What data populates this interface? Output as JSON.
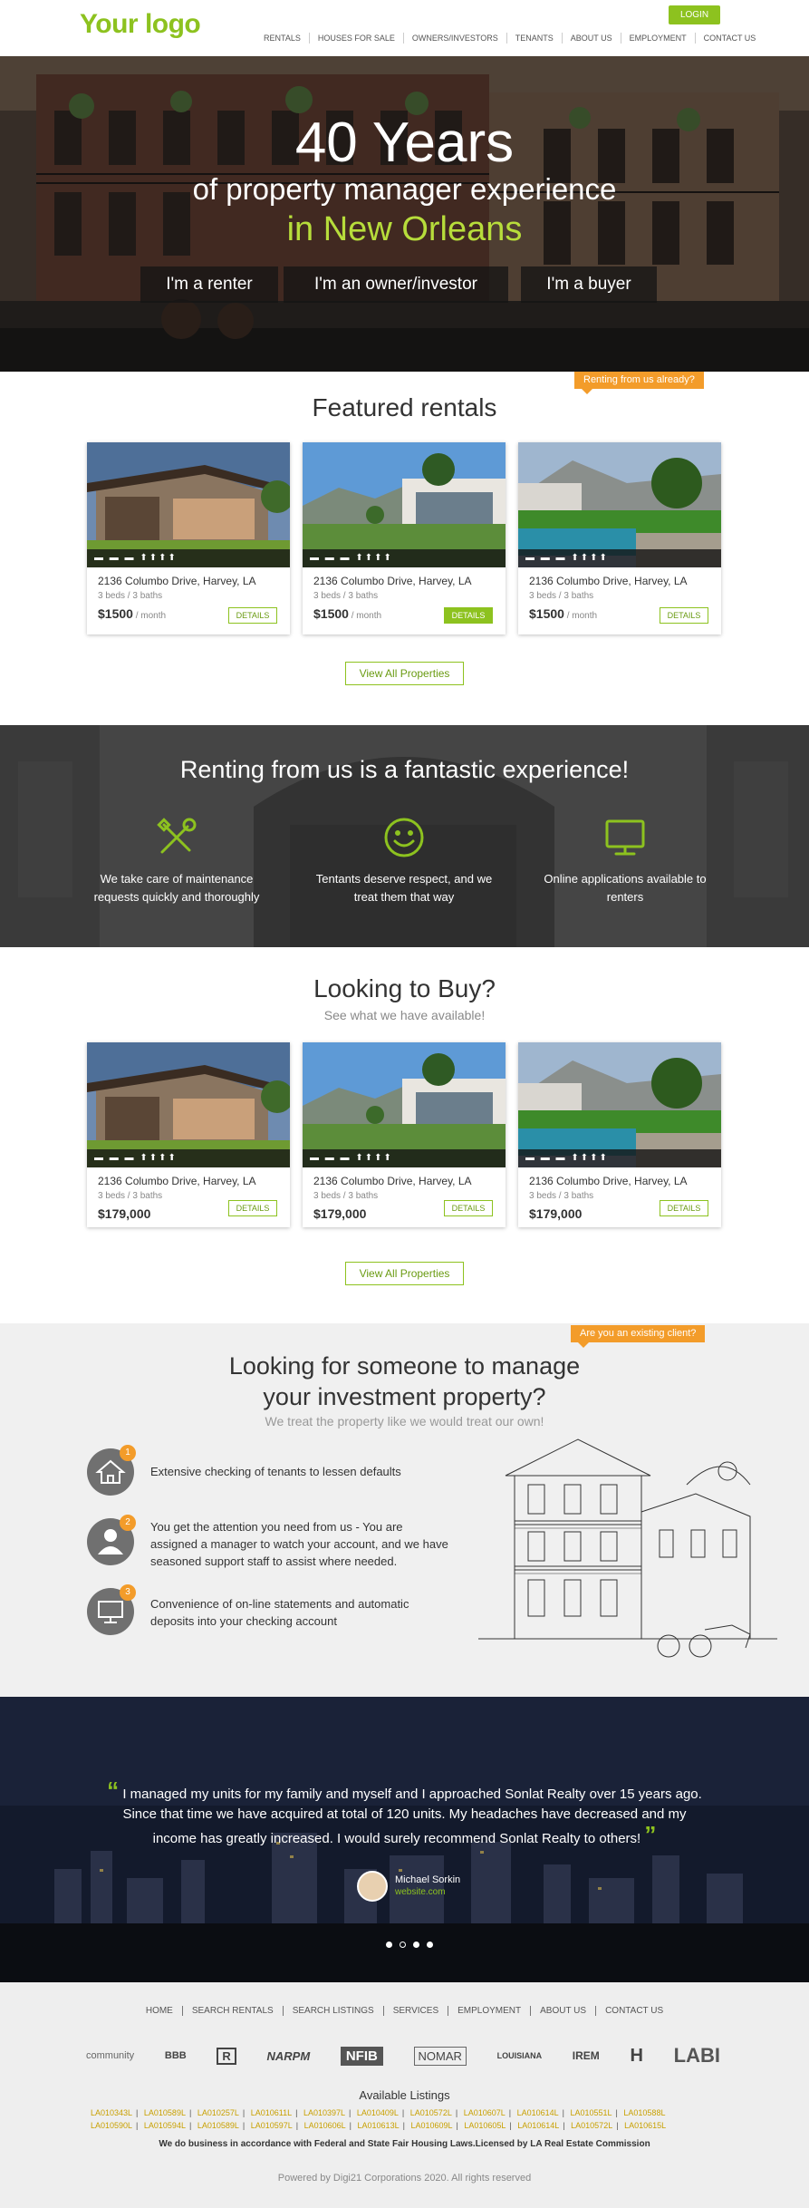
{
  "header": {
    "logo": "Your logo",
    "login": "LOGIN",
    "nav": [
      "RENTALS",
      "HOUSES FOR SALE",
      "OWNERS/INVESTORS",
      "TENANTS",
      "ABOUT US",
      "EMPLOYMENT",
      "CONTACT US"
    ]
  },
  "hero": {
    "title": "40 Years",
    "subtitle": "of property manager experience",
    "city": "in New Orleans",
    "buttons": [
      "I'm a renter",
      "I'm an owner/investor",
      "I'm a buyer"
    ]
  },
  "featured": {
    "tag": "Renting from us already?",
    "title": "Featured rentals",
    "cards": [
      {
        "address": "2136 Columbo Drive, Harvey, LA",
        "beds": "3 beds / 3 baths",
        "price": "$1500",
        "per": " / month",
        "details": "DETAILS"
      },
      {
        "address": "2136 Columbo Drive, Harvey, LA",
        "beds": "3 beds / 3 baths",
        "price": "$1500",
        "per": " / month",
        "details": "DETAILS"
      },
      {
        "address": "2136 Columbo Drive, Harvey, LA",
        "beds": "3 beds / 3 baths",
        "price": "$1500",
        "per": " / month",
        "details": "DETAILS"
      }
    ],
    "view_all": "View All Properties"
  },
  "renting": {
    "title": "Renting from us is a fantastic experience!",
    "features": [
      {
        "icon": "tools-icon",
        "text": "We take care of maintenance requests quickly and thoroughly"
      },
      {
        "icon": "smiley-icon",
        "text": "Tentants deserve respect, and we treat them that way"
      },
      {
        "icon": "monitor-icon",
        "text": "Online applications available to renters"
      }
    ]
  },
  "buy": {
    "title": "Looking to Buy?",
    "subtitle": "See what we have available!",
    "cards": [
      {
        "address": "2136 Columbo Drive, Harvey, LA",
        "beds": "3 beds / 3 baths",
        "price": "$179,000",
        "details": "DETAILS"
      },
      {
        "address": "2136 Columbo Drive, Harvey, LA",
        "beds": "3 beds / 3 baths",
        "price": "$179,000",
        "details": "DETAILS"
      },
      {
        "address": "2136 Columbo Drive, Harvey, LA",
        "beds": "3 beds / 3 baths",
        "price": "$179,000",
        "details": "DETAILS"
      }
    ],
    "view_all": "View All Properties"
  },
  "manage": {
    "tag": "Are you an existing client?",
    "title_line1": "Looking for someone to manage",
    "title_line2": "your investment property?",
    "subtitle": "We treat the property like we would treat our own!",
    "items": [
      {
        "icon": "house-icon",
        "badge": "1",
        "text": "Extensive checking of tenants to lessen defaults"
      },
      {
        "icon": "person-icon",
        "badge": "2",
        "text": "You get the attention you need from us - You are assigned a manager to watch your account, and we have seasoned support staff to assist where needed."
      },
      {
        "icon": "computer-icon",
        "badge": "3",
        "text": "Convenience of on-line statements and automatic deposits into your checking account"
      }
    ]
  },
  "testimonial": {
    "quote": "I managed my units for my family and myself and I approached Sonlat Realty over 15 years ago. Since that time we have acquired at total of 120 units. My headaches have decreased and my income has greatly increased. I would surely recommend Sonlat Realty to others!",
    "open_mark": "“",
    "close_mark": "”",
    "name": "Michael Sorkin",
    "site": "website.com"
  },
  "footer": {
    "nav": [
      "HOME",
      "SEARCH RENTALS",
      "SEARCH LISTINGS",
      "SERVICES",
      "EMPLOYMENT",
      "ABOUT US",
      "CONTACT US"
    ],
    "logos": [
      "community",
      "BBB",
      "R",
      "NARPM",
      "NFIB",
      "NOMAR",
      "LOUISIANA",
      "IREM",
      "H",
      "LABI"
    ],
    "available_title": "Available Listings",
    "listings_row1": [
      "LA010343L",
      "LA010589L",
      "LA010257L",
      "LA010611L",
      "LA010397L",
      "LA010409L",
      "LA010572L",
      "LA010607L",
      "LA010614L",
      "LA010551L",
      "LA010588L"
    ],
    "listings_row2": [
      "LA010590L",
      "LA010594L",
      "LA010589L",
      "LA010597L",
      "LA010606L",
      "LA010613L",
      "LA010609L",
      "LA010605L",
      "LA010614L",
      "LA010572L",
      "LA010615L"
    ],
    "business": "We do business in accordance with Federal and State Fair Housing Laws.Licensed by LA Real Estate Commission",
    "powered": "Powered by Digi21 Corporations 2020. All rights reserved"
  }
}
